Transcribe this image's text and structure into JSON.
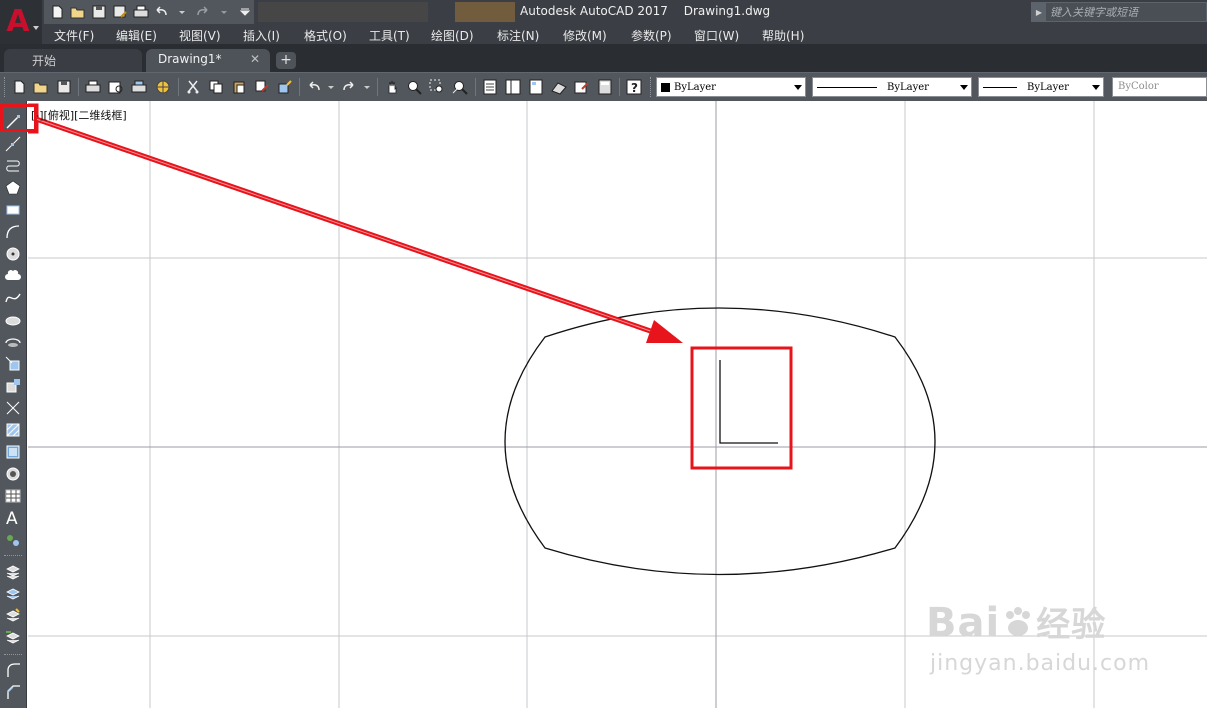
{
  "window": {
    "app_title": "Autodesk AutoCAD 2017",
    "file_name": "Drawing1.dwg",
    "search_placeholder": "键入关键字或短语"
  },
  "menu": [
    "文件(F)",
    "编辑(E)",
    "视图(V)",
    "插入(I)",
    "格式(O)",
    "工具(T)",
    "绘图(D)",
    "标注(N)",
    "修改(M)",
    "参数(P)",
    "窗口(W)",
    "帮助(H)"
  ],
  "tabs": {
    "start_label": "开始",
    "drawing_label": "Drawing1*",
    "close_glyph": "✕",
    "add_glyph": "+"
  },
  "properties": {
    "color": "ByLayer",
    "linetype": "ByLayer",
    "lineweight": "ByLayer",
    "plotstyle": "ByColor"
  },
  "viewport": {
    "label": "[-][俯视][二维线框]"
  },
  "watermark": {
    "brand": "Bai",
    "brand_cn": "经验",
    "url": "jingyan.baidu.com"
  },
  "colors": {
    "annotation_red": "#e8141c",
    "ui_dark": "#3b3f45",
    "ui_mid": "#52575e",
    "grid": "#c5c8cd",
    "axis": "#9a9ea5"
  },
  "icons": {
    "quick_access": [
      "new-icon",
      "open-icon",
      "save-icon",
      "save-as-icon",
      "plot-icon",
      "undo-icon",
      "redo-icon",
      "customize-icon"
    ],
    "left_draw": [
      "line-icon",
      "construction-line-icon",
      "polyline-icon",
      "polygon-icon",
      "rectangle-icon",
      "arc-icon",
      "circle-icon",
      "revision-cloud-icon",
      "spline-icon",
      "ellipse-icon",
      "ellipse-arc-icon",
      "insert-block-icon",
      "make-block-icon",
      "point-icon",
      "hatch-icon",
      "gradient-icon",
      "region-icon",
      "table-icon",
      "text-icon",
      "add-selected-icon",
      "layer-icon",
      "layer-properties-icon",
      "layer-match-icon",
      "layer-previous-icon",
      "fillet-icon",
      "chamfer-icon"
    ]
  }
}
